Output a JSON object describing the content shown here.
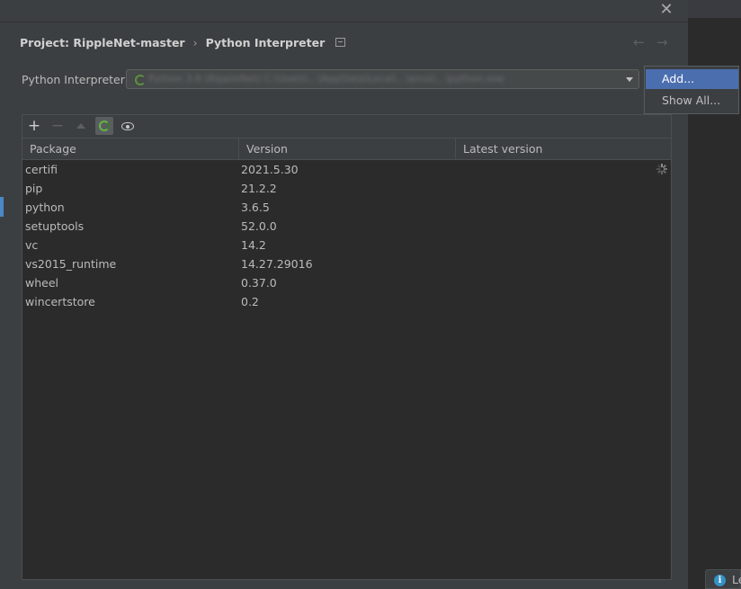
{
  "dialog": {
    "close_glyph": "✕",
    "breadcrumb": {
      "project": "Project: RippleNet-master",
      "separator": "›",
      "page": "Python Interpreter"
    },
    "nav": {
      "back_glyph": "←",
      "forward_glyph": "→"
    }
  },
  "interpreter": {
    "label": "Python Interpreter:",
    "value_blurred": "Python 3.6 (RippleNet) C:\\Users\\...\\AppData\\Local\\...\\envs\\...\\python.exe"
  },
  "popup_menu": {
    "items": [
      {
        "label": "Add...",
        "selected": true
      },
      {
        "label": "Show All...",
        "selected": false
      }
    ]
  },
  "toolbar": {
    "add_glyph": "+",
    "remove_glyph": "−"
  },
  "packages_table": {
    "columns": [
      "Package",
      "Version",
      "Latest version"
    ],
    "rows": [
      {
        "package": "certifi",
        "version": "2021.5.30"
      },
      {
        "package": "pip",
        "version": "21.2.2"
      },
      {
        "package": "python",
        "version": "3.6.5"
      },
      {
        "package": "setuptools",
        "version": "52.0.0"
      },
      {
        "package": "vc",
        "version": "14.2"
      },
      {
        "package": "vs2015_runtime",
        "version": "14.27.29016"
      },
      {
        "package": "wheel",
        "version": "0.37.0"
      },
      {
        "package": "wincertstore",
        "version": "0.2"
      }
    ]
  },
  "notification": {
    "icon_glyph": "i",
    "text": "Le"
  },
  "colors": {
    "dialog_bg": "#3c3f41",
    "table_bg": "#2b2b2b",
    "selection": "#4b6eaf",
    "accent_green": "#62b543"
  }
}
